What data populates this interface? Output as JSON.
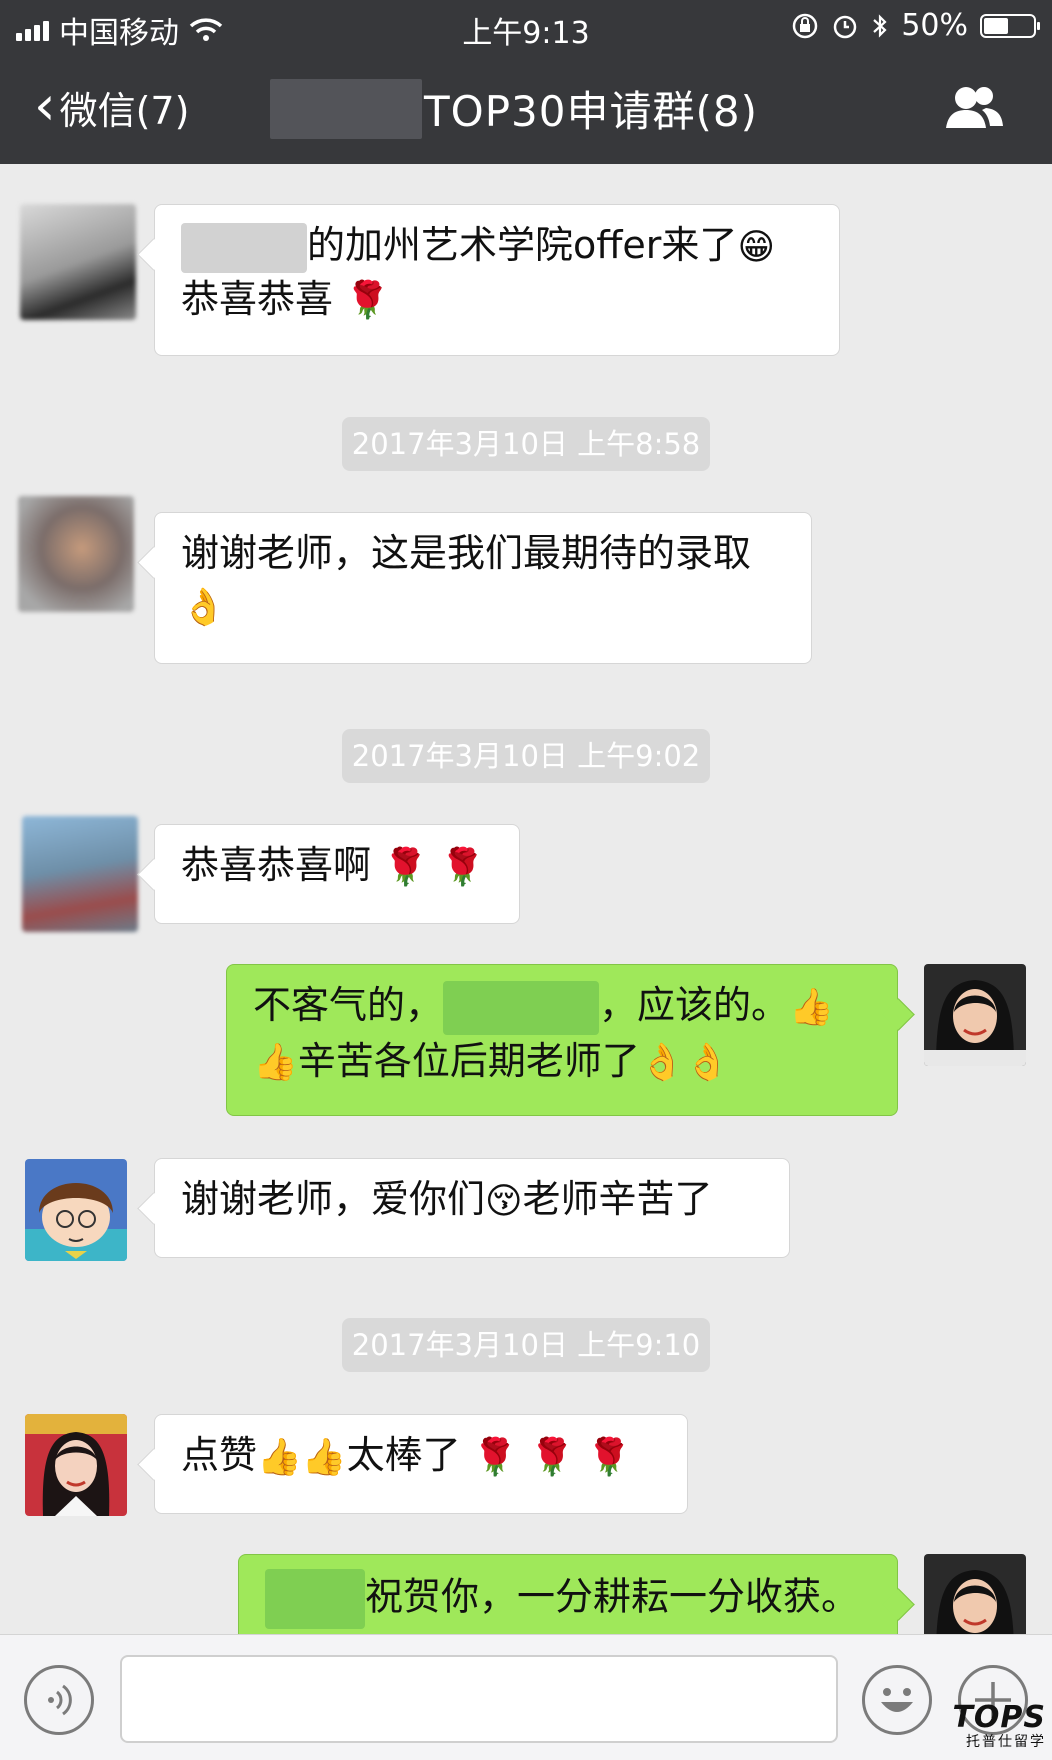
{
  "status_bar": {
    "carrier": "中国移动",
    "time": "上午9:13",
    "battery": "50%"
  },
  "nav": {
    "back_label": "微信(7)",
    "title": "TOP30申请群(8)"
  },
  "messages": [
    {
      "type": "in",
      "text_after": "的加州艺术学院offer来了",
      "emoji1": "😁",
      "line2": "恭喜恭喜",
      "emoji2": "🌹"
    },
    {
      "type": "timestamp",
      "text": "2017年3月10日  上午8:58"
    },
    {
      "type": "in",
      "text": "谢谢老师，这是我们最期待的录取",
      "emoji1": "👌"
    },
    {
      "type": "timestamp",
      "text": "2017年3月10日  上午9:02"
    },
    {
      "type": "in",
      "text": "恭喜恭喜啊",
      "emoji1": "🌹",
      "emoji2": "🌹"
    },
    {
      "type": "out",
      "text_a": "不客气的，",
      "text_b": "，应该的。",
      "emoji1": "👍",
      "emoji2": "👍",
      "line2": "辛苦各位后期老师了",
      "emoji3": "👌",
      "emoji4": "👌"
    },
    {
      "type": "in",
      "text_a": "谢谢老师，爱你们",
      "emoji1": "😚",
      "text_b": "老师辛苦了"
    },
    {
      "type": "timestamp",
      "text": "2017年3月10日  上午9:10"
    },
    {
      "type": "in",
      "text_a": "点赞",
      "emoji1": "👍",
      "emoji2": "👍",
      "text_b": "太棒了",
      "emoji3": "🌹",
      "emoji4": "🌹",
      "emoji5": "🌹"
    },
    {
      "type": "out",
      "text": "祝贺你，一分耕耘一分收获。"
    }
  ],
  "watermark": {
    "logo": "TOPS",
    "sub": "托普仕留学"
  },
  "colors": {
    "header_bg": "#37383b",
    "chat_bg": "#ebebeb",
    "out_bubble": "#9fe85a",
    "timestamp_bg": "#d9d9d9"
  }
}
